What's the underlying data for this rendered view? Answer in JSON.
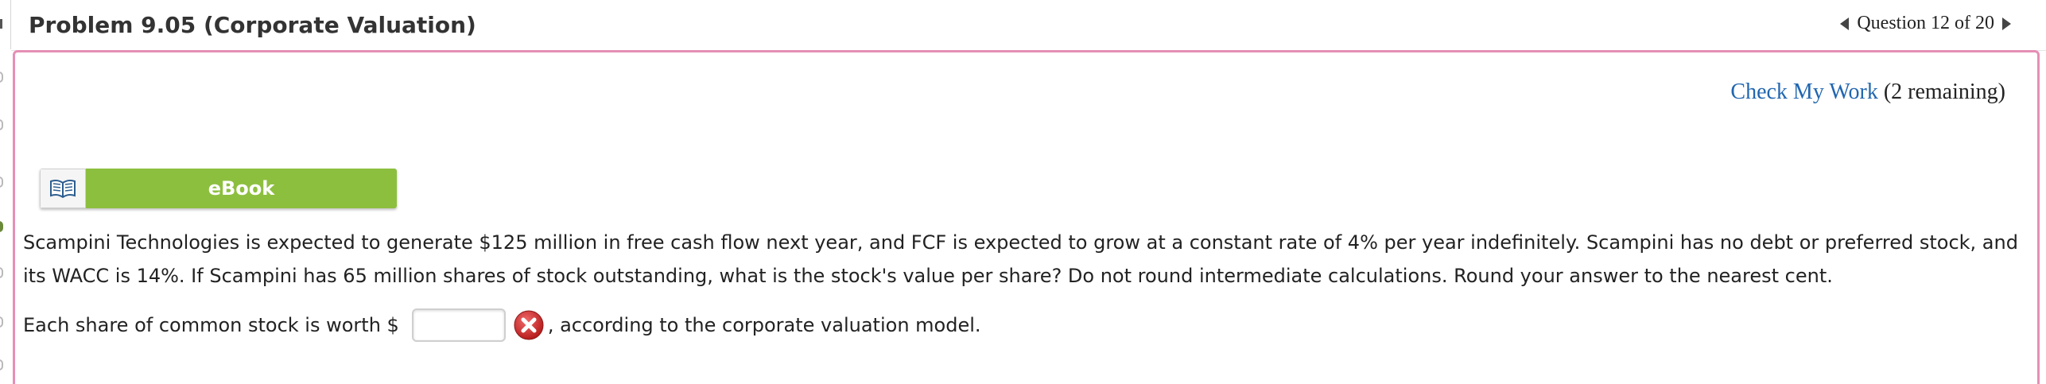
{
  "header": {
    "title": "Problem 9.05 (Corporate Valuation)",
    "question_nav": "Question 12 of 20"
  },
  "check": {
    "link_label": "Check My Work",
    "remaining": "(2 remaining)"
  },
  "ebook": {
    "label": "eBook",
    "icon": "open-book-icon"
  },
  "problem": {
    "text": "Scampini Technologies is expected to generate $125 million in free cash flow next year, and FCF is expected to grow at a constant rate of 4% per year indefinitely. Scampini has no debt or preferred stock, and its WACC is 14%. If Scampini has 65 million shares of stock outstanding, what is the stock's value per share? Do not round intermediate calculations. Round your answer to the nearest cent."
  },
  "answer": {
    "prefix": "Each share of common stock is worth $",
    "value": "",
    "status_icon": "incorrect-x-icon",
    "suffix": ", according to the corporate valuation model."
  },
  "colors": {
    "accent_link": "#2166b0",
    "ebook_green": "#8dbf3f",
    "panel_border": "#e58fb6",
    "error_red": "#c62828"
  }
}
